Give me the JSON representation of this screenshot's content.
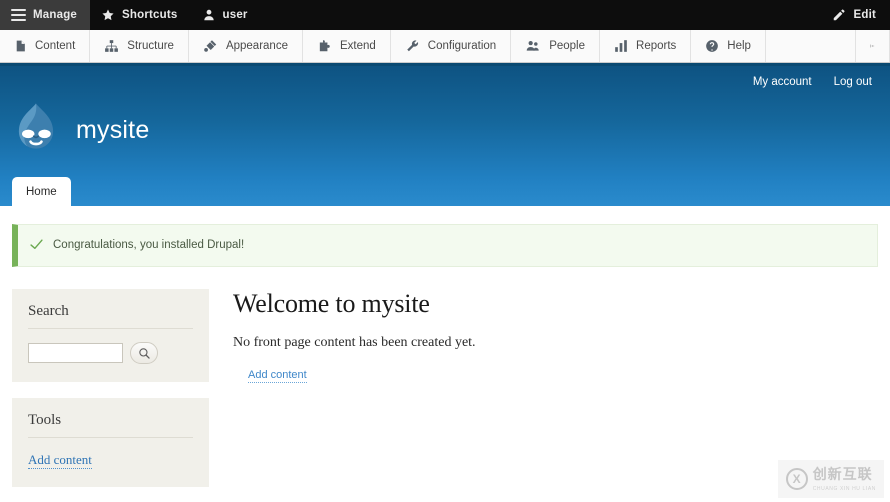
{
  "toolbar": {
    "items": [
      {
        "label": "Manage",
        "icon": "hamburger-icon",
        "active": true
      },
      {
        "label": "Shortcuts",
        "icon": "star-icon",
        "active": false
      },
      {
        "label": "user",
        "icon": "user-icon",
        "active": false
      }
    ],
    "edit": {
      "label": "Edit",
      "icon": "pencil-icon"
    }
  },
  "admin_menu": {
    "items": [
      {
        "label": "Content",
        "icon": "file-icon"
      },
      {
        "label": "Structure",
        "icon": "sitemap-icon"
      },
      {
        "label": "Appearance",
        "icon": "paintbrush-icon"
      },
      {
        "label": "Extend",
        "icon": "puzzle-piece-icon"
      },
      {
        "label": "Configuration",
        "icon": "wrench-icon"
      },
      {
        "label": "People",
        "icon": "people-icon"
      },
      {
        "label": "Reports",
        "icon": "bar-chart-icon"
      },
      {
        "label": "Help",
        "icon": "question-mark-icon"
      }
    ],
    "orientation_toggle": "toolbar-orientation-toggle-icon"
  },
  "header": {
    "user_links": [
      {
        "label": "My account"
      },
      {
        "label": "Log out"
      }
    ],
    "site_name": "mysite",
    "logo": "drupal-droplet-logo",
    "tabs": [
      {
        "label": "Home",
        "active": true
      }
    ]
  },
  "status_message": {
    "icon": "checkmark-icon",
    "text": "Congratulations, you installed Drupal!"
  },
  "sidebar": {
    "blocks": [
      {
        "title": "Search",
        "search": {
          "value": "",
          "placeholder": "",
          "button_icon": "magnifier-icon"
        }
      },
      {
        "title": "Tools",
        "links": [
          {
            "label": "Add content"
          }
        ]
      }
    ]
  },
  "main": {
    "heading": "Welcome to mysite",
    "body": "No front page content has been created yet.",
    "link": "Add content"
  },
  "watermark": {
    "mark": "X",
    "chinese": "创新互联",
    "pinyin": "CHUANG XIN HU LIAN"
  },
  "colors": {
    "toolbar_bg": "#0d0d0d",
    "header_blue_top": "#0e5382",
    "header_blue_bottom": "#2a8bcd",
    "status_green": "#77b259",
    "link_blue": "#3f87c9",
    "block_bg": "#f1f0ea"
  }
}
